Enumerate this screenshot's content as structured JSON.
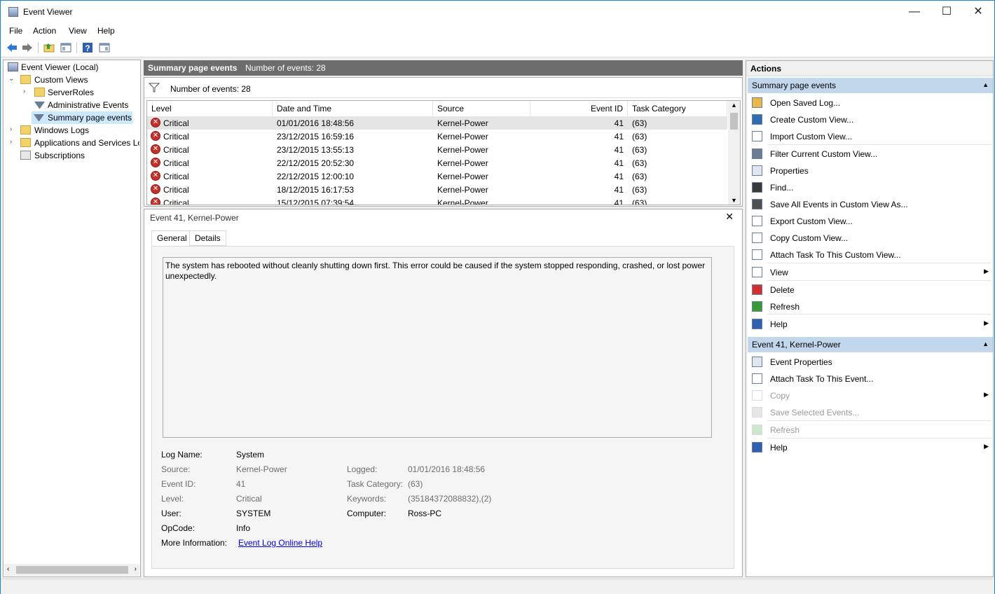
{
  "window": {
    "title": "Event Viewer",
    "minimize": "—",
    "maximize": "☐",
    "close": "✕"
  },
  "menu": [
    "File",
    "Action",
    "View",
    "Help"
  ],
  "tree": {
    "root": "Event Viewer (Local)",
    "custom_views": "Custom Views",
    "server_roles": "ServerRoles",
    "admin_events": "Administrative Events",
    "summary_events": "Summary page events",
    "windows_logs": "Windows Logs",
    "app_services": "Applications and Services Lo",
    "subscriptions": "Subscriptions"
  },
  "center": {
    "header_title": "Summary page events",
    "header_count": "Number of events: 28",
    "filter_label": "Number of events: 28",
    "columns": [
      "Level",
      "Date and Time",
      "Source",
      "Event ID",
      "Task Category"
    ],
    "rows": [
      {
        "level": "Critical",
        "datetime": "01/01/2016 18:48:56",
        "source": "Kernel-Power",
        "event_id": "41",
        "task": "(63)"
      },
      {
        "level": "Critical",
        "datetime": "23/12/2015 16:59:16",
        "source": "Kernel-Power",
        "event_id": "41",
        "task": "(63)"
      },
      {
        "level": "Critical",
        "datetime": "23/12/2015 13:55:13",
        "source": "Kernel-Power",
        "event_id": "41",
        "task": "(63)"
      },
      {
        "level": "Critical",
        "datetime": "22/12/2015 20:52:30",
        "source": "Kernel-Power",
        "event_id": "41",
        "task": "(63)"
      },
      {
        "level": "Critical",
        "datetime": "22/12/2015 12:00:10",
        "source": "Kernel-Power",
        "event_id": "41",
        "task": "(63)"
      },
      {
        "level": "Critical",
        "datetime": "18/12/2015 16:17:53",
        "source": "Kernel-Power",
        "event_id": "41",
        "task": "(63)"
      },
      {
        "level": "Critical",
        "datetime": "15/12/2015 07:39:54",
        "source": "Kernel-Power",
        "event_id": "41",
        "task": "(63)"
      }
    ]
  },
  "detail": {
    "title": "Event 41, Kernel-Power",
    "tab_general": "General",
    "tab_details": "Details",
    "message": "The system has rebooted without cleanly shutting down first. This error could be caused if the system stopped responding, crashed, or lost power unexpectedly.",
    "labels": {
      "log_name": "Log Name:",
      "source": "Source:",
      "event_id": "Event ID:",
      "level": "Level:",
      "user": "User:",
      "opcode": "OpCode:",
      "more_info": "More Information:",
      "logged": "Logged:",
      "task_category": "Task Category:",
      "keywords": "Keywords:",
      "computer": "Computer:"
    },
    "values": {
      "log_name": "System",
      "source": "Kernel-Power",
      "event_id": "41",
      "level": "Critical",
      "user": "SYSTEM",
      "opcode": "Info",
      "more_info": "Event Log Online Help",
      "logged": "01/01/2016 18:48:56",
      "task_category": "(63)",
      "keywords": "(35184372088832),(2)",
      "computer": "Ross-PC"
    }
  },
  "actions": {
    "title": "Actions",
    "section1": "Summary page events",
    "items1": [
      "Open Saved Log...",
      "Create Custom View...",
      "Import Custom View...",
      "Filter Current Custom View...",
      "Properties",
      "Find...",
      "Save All Events in Custom View As...",
      "Export Custom View...",
      "Copy Custom View...",
      "Attach Task To This Custom View...",
      "View",
      "Delete",
      "Refresh",
      "Help"
    ],
    "section2": "Event 41, Kernel-Power",
    "items2": [
      "Event Properties",
      "Attach Task To This Event...",
      "Copy",
      "Save Selected Events...",
      "Refresh",
      "Help"
    ]
  }
}
